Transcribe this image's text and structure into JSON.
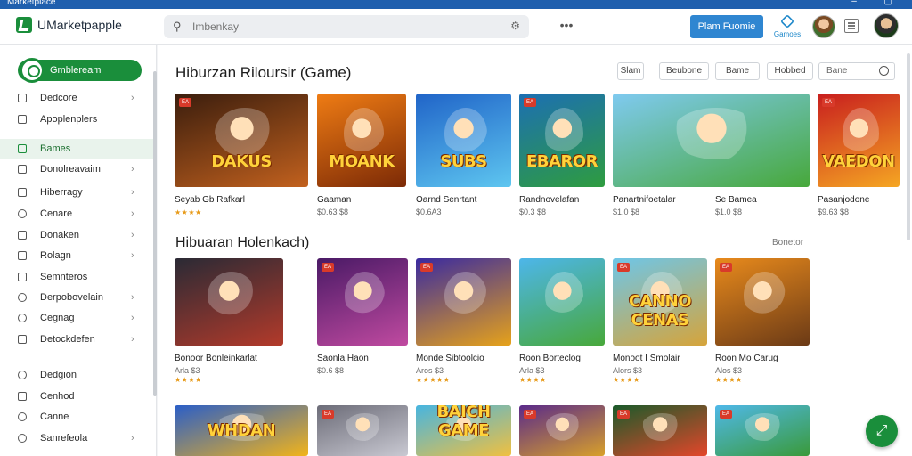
{
  "window": {
    "title": "Marketplace"
  },
  "topbar": {
    "app_name": "UMarketpapple",
    "search_placeholder": "Imbenkay",
    "more_label": "•••",
    "primary_button": "Plam Fuomie",
    "store_label": "Gamoes"
  },
  "sidebar": {
    "primary": "Gmbleream",
    "groups": [
      {
        "label": "Dedcore",
        "icon": "home-icon",
        "chevron": true
      },
      {
        "label": "Apoplenplers",
        "icon": "apps-icon",
        "chevron": false
      },
      {
        "label": "Bames",
        "icon": "gamepad-icon",
        "chevron": false,
        "active": true
      },
      {
        "label": "Donolreavaim",
        "icon": "download-icon",
        "chevron": true
      },
      {
        "label": "Hiberragy",
        "icon": "library-icon",
        "chevron": true
      },
      {
        "label": "Cenare",
        "icon": "location-icon",
        "chevron": true
      },
      {
        "label": "Donaken",
        "icon": "calendar-icon",
        "chevron": true
      },
      {
        "label": "Rolagn",
        "icon": "pin-icon",
        "chevron": true
      },
      {
        "label": "Semnteros",
        "icon": "tag-icon",
        "chevron": false
      },
      {
        "label": "Derpobovelain",
        "icon": "settings-icon",
        "chevron": true
      },
      {
        "label": "Cegnag",
        "icon": "search-icon",
        "chevron": true
      },
      {
        "label": "Detockdefen",
        "icon": "list-icon",
        "chevron": true
      },
      {
        "label": "Dedgion",
        "icon": "help-icon",
        "chevron": false
      },
      {
        "label": "Cenhod",
        "icon": "lock-icon",
        "chevron": false
      },
      {
        "label": "Canne",
        "icon": "user-icon",
        "chevron": false
      },
      {
        "label": "Sanrefeola",
        "icon": "gear-icon",
        "chevron": true
      }
    ]
  },
  "section1": {
    "title": "Hiburzan Riloursir (Game)",
    "filters": [
      "Slam",
      "Beubone",
      "Bame",
      "Hobbed"
    ],
    "filter_search": "Bane"
  },
  "section2": {
    "title": "Hibuaran Holenkach)",
    "see_all": "Bonetor"
  },
  "row1": [
    {
      "title": "Seyab Gb Rafkarl",
      "sub": "",
      "stars": "★★★★",
      "word": "DAKUS",
      "badge": "EA",
      "colors": [
        "#3a1d0d",
        "#c2611e"
      ]
    },
    {
      "title": "Gaaman",
      "sub": "$0.63 $8",
      "stars": "",
      "word": "MOANK",
      "badge": "",
      "colors": [
        "#ef7c14",
        "#7c2a06"
      ]
    },
    {
      "title": "Oarnd Senrtant",
      "sub": "$0.6A3",
      "stars": "",
      "word": "SUBS",
      "badge": "",
      "colors": [
        "#2064c8",
        "#5ec6f0"
      ]
    },
    {
      "title": "Randnovelafan",
      "sub": "$0.3 $8",
      "stars": "",
      "word": "EBAROR",
      "badge": "EA",
      "colors": [
        "#1c6fb3",
        "#2e9c3f"
      ]
    },
    {
      "title": "Panartnifoetalar",
      "sub": "$1.0 $8",
      "stars": "",
      "word": "",
      "badge": "",
      "colors": [
        "#7fcaf0",
        "#47a83a"
      ]
    },
    {
      "title": "Se Bamea",
      "sub": "$1.0 $8",
      "stars": "",
      "word": "",
      "badge": "",
      "colors": [
        "#8ad7ff",
        "#63c043"
      ]
    },
    {
      "title": "Pasanjodone",
      "sub": "$9.63 $8",
      "stars": "",
      "word": "VAEDON",
      "badge": "EA",
      "colors": [
        "#c81e1e",
        "#f5a623"
      ]
    }
  ],
  "row2": [
    {
      "title": "Bonoor Bonleinkarlat",
      "sub": "Arla $3",
      "stars": "★★★★",
      "word": "",
      "badge": "",
      "colors": [
        "#2a2a35",
        "#b33a2a"
      ]
    },
    {
      "title": "Saonla Haon",
      "sub": "$0.6 $8",
      "stars": "",
      "word": "",
      "badge": "EA",
      "colors": [
        "#4a1a66",
        "#c04aa0"
      ]
    },
    {
      "title": "Monde Sibtoolcio",
      "sub": "Aros $3",
      "stars": "★★★★★",
      "word": "",
      "badge": "EA",
      "colors": [
        "#3a2aa0",
        "#e6a21a"
      ]
    },
    {
      "title": "Roon Borteclog",
      "sub": "Arla $3",
      "stars": "★★★★",
      "word": "",
      "badge": "",
      "colors": [
        "#4db6ea",
        "#48a83a"
      ]
    },
    {
      "title": "Monoot I Smolair",
      "sub": "Alors $3",
      "stars": "★★★★",
      "word": "CANNO CENAS",
      "badge": "EA",
      "colors": [
        "#6ec6e8",
        "#d6a43a"
      ]
    },
    {
      "title": "Roon Mo Carug",
      "sub": "Alos $3",
      "stars": "★★★★",
      "word": "",
      "badge": "EA",
      "colors": [
        "#e88a1c",
        "#6b3a16"
      ]
    }
  ],
  "row3": [
    {
      "word": "WHDAN",
      "badge": "",
      "colors": [
        "#2a5ec8",
        "#f2b41a"
      ]
    },
    {
      "word": "",
      "badge": "EA",
      "colors": [
        "#6c6c78",
        "#c9c9d2"
      ]
    },
    {
      "word": "BAICH GAME",
      "badge": "",
      "colors": [
        "#47b5e0",
        "#f0c040"
      ]
    },
    {
      "word": "",
      "badge": "EA",
      "colors": [
        "#5a2a8a",
        "#d8a02a"
      ]
    },
    {
      "word": "",
      "badge": "EA",
      "colors": [
        "#1a5a2a",
        "#e4462a"
      ]
    },
    {
      "word": "",
      "badge": "EA",
      "colors": [
        "#4fb8e8",
        "#3a9a3a"
      ]
    }
  ],
  "colors": {
    "accent_green": "#1a8e3b",
    "primary_blue": "#2f86d1",
    "titlebar": "#1f5fae"
  }
}
